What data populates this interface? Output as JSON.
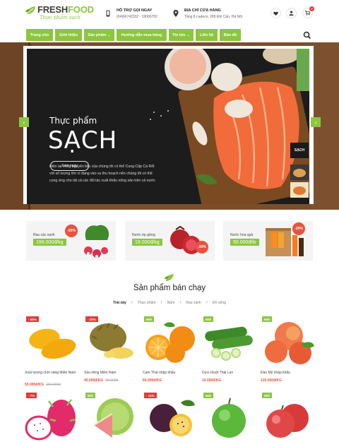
{
  "header": {
    "brand_fresh": "FRESH",
    "brand_food": "FOOD",
    "tagline": "Thực phẩm sạch",
    "support_title": "HỖ TRỢ GỌI NGAY",
    "support_phone": "(04)66742332 - 19006750",
    "address_title": "ĐỊA CHỈ CỬA HÀNG",
    "address_value": "Tầng 8 Ladeco, 266 Đội Cấn, Hà Nội",
    "cart_count": "0"
  },
  "nav": {
    "items": [
      "Trang chủ",
      "Giới thiệu",
      "Sản phẩm ⌄",
      "Hướng dẫn mua hàng",
      "Tin tức ⌄",
      "Liên hệ",
      "Bản đồ"
    ]
  },
  "hero": {
    "title_small": "Thực phẩm",
    "title_big": "SẠCH",
    "description": "Hiện tại vùng nguyên liệu của chúng tôi có thể Cung Cấp Cà Rốt với số lượng lớn vì đang vào vụ thu hoạch nên chúng tôi có thể cung ứng cho tất cả các đối tác xuất khẩu nông sản trên cả nước",
    "button": "Xem ngay",
    "thumb_label": "SẠCH",
    "prev": "‹",
    "next": "›"
  },
  "promos": [
    {
      "label": "Rau các xanh",
      "price": "199.000đ/kg",
      "discount": "-20%"
    },
    {
      "label": "Nước ép gừng",
      "price": "19.000đ/kg",
      "discount": "-30%"
    },
    {
      "label": "Nước hoa quả",
      "price": "50.000đ/lo",
      "discount": "-20%"
    }
  ],
  "section": {
    "title": "Sản phẩm bán chạy",
    "tabs": [
      "Trái cây",
      "Thực phẩm",
      "Nấm",
      "Rau xanh",
      "Đồ uống"
    ],
    "separator": "/"
  },
  "products": [
    {
      "tag": "- 66%",
      "name": "Xoài tượng chín vàng Miền Nam",
      "price": "55.000đ/KG",
      "old": "150.000đ"
    },
    {
      "tag": "- 25%",
      "name": "Sầu riêng Miền Nam",
      "price": "45.000đ/KG",
      "old": "60.000đ"
    },
    {
      "tag": "Mới",
      "name": "Cam Thái nhập khẩu",
      "price": "60.000đ/KG",
      "old": ""
    },
    {
      "tag": "Mới",
      "name": "Dưa chuột Thái Lan",
      "price": "15.000đ/KG",
      "old": ""
    },
    {
      "tag": "Mới",
      "name": "Đào Mỹ nhập khẩu",
      "price": "120.000đ/KG",
      "old": ""
    },
    {
      "tag": "- 7%",
      "name": "",
      "price": "",
      "old": ""
    },
    {
      "tag": "Mới",
      "name": "",
      "price": "",
      "old": ""
    },
    {
      "tag": "- 11%",
      "name": "",
      "price": "",
      "old": ""
    },
    {
      "tag": "Mới",
      "name": "",
      "price": "",
      "old": ""
    },
    {
      "tag": "Mới",
      "name": "",
      "price": "",
      "old": ""
    }
  ],
  "colors": {
    "accent": "#8cc63f",
    "sale": "#e53935",
    "price": "#e8523f",
    "board": "#1c1c1c",
    "wood": "#7a4e2d"
  },
  "icons": [
    "leaf-icon",
    "phone-icon",
    "location-icon",
    "heart-icon",
    "user-icon",
    "cart-icon",
    "search-icon"
  ]
}
